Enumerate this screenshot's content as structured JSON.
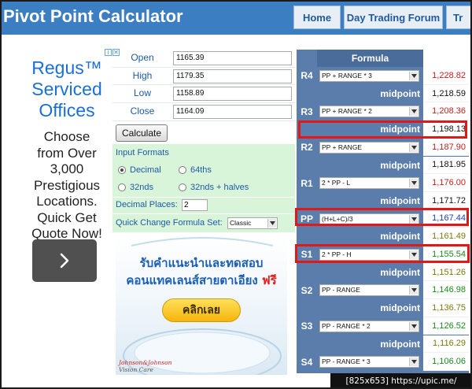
{
  "header": {
    "title": "Pivot Point Calculator",
    "nav": [
      "Home",
      "Day Trading Forum",
      "Tr"
    ]
  },
  "ad": {
    "badge_icons": [
      "info-icon",
      "close-icon"
    ],
    "headline": [
      "Regus™",
      "Serviced",
      "Offices"
    ],
    "body": [
      "Choose",
      "from Over",
      "3,000",
      "Prestigious",
      "Locations.",
      "Quick Get",
      "Quote Now!"
    ]
  },
  "inputs": [
    {
      "label": "Open",
      "value": "1165.39"
    },
    {
      "label": "High",
      "value": "1179.35"
    },
    {
      "label": "Low",
      "value": "1158.89"
    },
    {
      "label": "Close",
      "value": "1164.09"
    }
  ],
  "calculate_label": "Calculate",
  "formats": {
    "title": "Input Formats",
    "options": [
      "Decimal",
      "64ths",
      "32nds",
      "32nds + halves"
    ],
    "selected": "Decimal"
  },
  "decimals": {
    "label": "Decimal Places:",
    "value": "2"
  },
  "quick": {
    "label": "Quick Change Formula Set:",
    "value": "Classic"
  },
  "banner": {
    "line1": "รับคำแนะนำและทดสอบ",
    "line2": "คอนแทคเลนส์สายตาเอียง",
    "free": "ฟรี",
    "cta": "คลิกเลย",
    "brand": "Johnson&Johnson",
    "brand_sub": "Vision Care"
  },
  "table": {
    "header": "Formula",
    "rows": [
      {
        "label": "R4",
        "formula": "PP + RANGE * 3",
        "value": "1,228.82",
        "color": "#c81e1e"
      },
      {
        "label": "",
        "formula": "midpoint",
        "value": "1,218.59",
        "color": "#111111"
      },
      {
        "label": "R3",
        "formula": "PP + RANGE * 2",
        "value": "1,208.36",
        "color": "#c81e1e"
      },
      {
        "label": "",
        "formula": "midpoint",
        "value": "1,198.13",
        "color": "#111111"
      },
      {
        "label": "R2",
        "formula": "PP + RANGE",
        "value": "1,187.90",
        "color": "#c81e1e"
      },
      {
        "label": "",
        "formula": "midpoint",
        "value": "1,181.95",
        "color": "#111111"
      },
      {
        "label": "R1",
        "formula": "2 * PP - L",
        "value": "1,176.00",
        "color": "#c81e1e"
      },
      {
        "label": "",
        "formula": "midpoint",
        "value": "1,171.72",
        "color": "#111111"
      },
      {
        "label": "PP",
        "formula": "(H+L+C)/3",
        "value": "1,167.44",
        "color": "#1d3fbf"
      },
      {
        "label": "",
        "formula": "midpoint",
        "value": "1,161.49",
        "color": "#7a7a0a"
      },
      {
        "label": "S1",
        "formula": "2 * PP - H",
        "value": "1,155.54",
        "color": "#1a8a1a"
      },
      {
        "label": "",
        "formula": "midpoint",
        "value": "1,151.26",
        "color": "#7a7a0a"
      },
      {
        "label": "S2",
        "formula": "PP - RANGE",
        "value": "1,146.98",
        "color": "#1a8a1a"
      },
      {
        "label": "",
        "formula": "midpoint",
        "value": "1,136.75",
        "color": "#7a7a0a"
      },
      {
        "label": "S3",
        "formula": "PP - RANGE * 2",
        "value": "1,126.52",
        "color": "#1a8a1a"
      },
      {
        "label": "",
        "formula": "midpoint",
        "value": "1,116.29",
        "color": "#7a7a0a"
      },
      {
        "label": "S4",
        "formula": "PP - RANGE * 3",
        "value": "1,106.06",
        "color": "#1a8a1a"
      }
    ]
  },
  "footer": "[825x653] https://upic.me/",
  "colors": {
    "highlight": "#e01818",
    "header_bg": "#3b7ec2",
    "table_bg": "#5b7dab"
  }
}
